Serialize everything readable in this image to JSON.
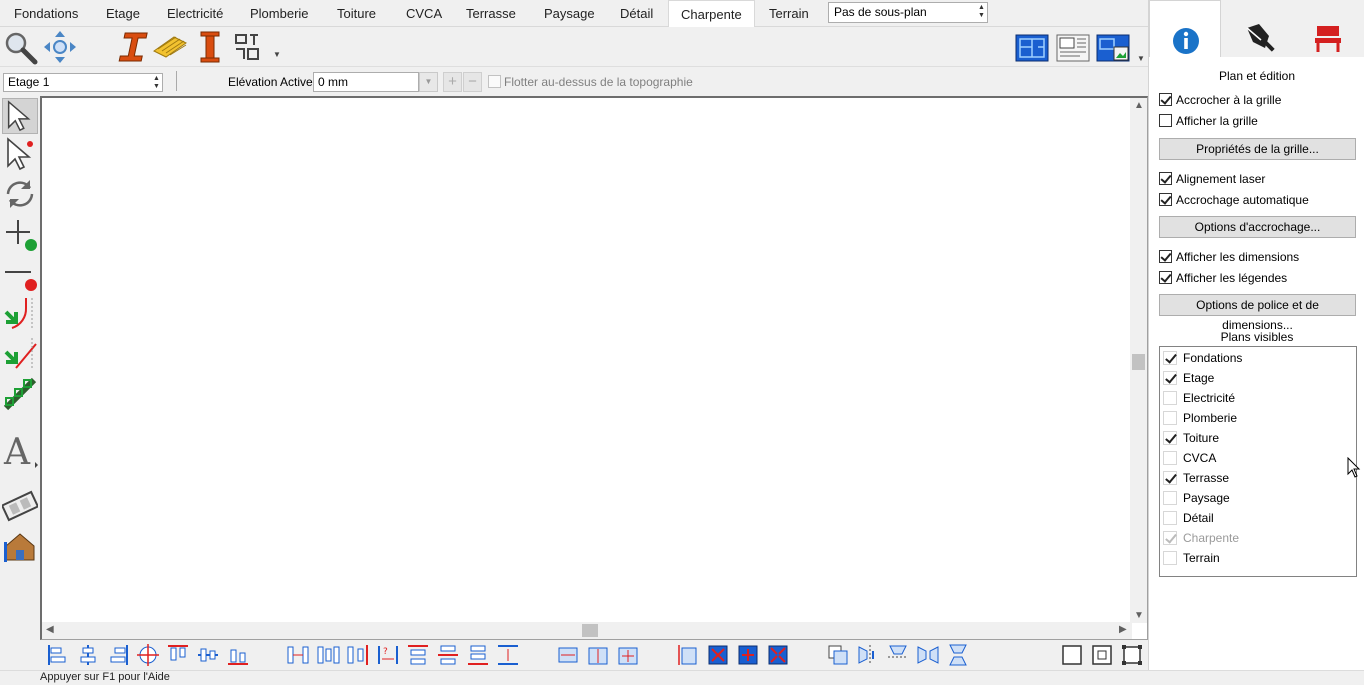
{
  "tabs": [
    "Fondations",
    "Etage",
    "Electricité",
    "Plomberie",
    "Toiture",
    "CVCA",
    "Terrasse",
    "Paysage",
    "Détail",
    "Charpente",
    "Terrain"
  ],
  "active_tab": "Charpente",
  "subplan": {
    "value": "Pas de sous-plan"
  },
  "level_row": {
    "level": "Etage 1",
    "elevation_label": "Elévation Active:",
    "elevation_value": "0 mm",
    "float_label": "Flotter au-dessus de la topographie",
    "float_checked": false
  },
  "panel": {
    "section_title": "Plan et édition",
    "snap_grid": "Accrocher à la grille",
    "show_grid": "Afficher la grille",
    "grid_props_button": "Propriétés de la grille...",
    "laser_align": "Alignement laser",
    "auto_snap": "Accrochage automatique",
    "snap_options_button": "Options d'accrochage...",
    "show_dimensions": "Afficher les dimensions",
    "show_legends": "Afficher les légendes",
    "font_dim_button": "Options de police et de dimensions...",
    "visible_plans_title": "Plans visibles",
    "visible_plans": [
      {
        "name": "Fondations",
        "checked": true
      },
      {
        "name": "Etage",
        "checked": true
      },
      {
        "name": "Electricité",
        "checked": false
      },
      {
        "name": "Plomberie",
        "checked": false
      },
      {
        "name": "Toiture",
        "checked": true
      },
      {
        "name": "CVCA",
        "checked": false
      },
      {
        "name": "Terrasse",
        "checked": true
      },
      {
        "name": "Paysage",
        "checked": false
      },
      {
        "name": "Détail",
        "checked": false
      },
      {
        "name": "Charpente",
        "checked": true,
        "disabled": true
      },
      {
        "name": "Terrain",
        "checked": false
      }
    ]
  },
  "status": "Appuyer sur F1 pour l'Aide",
  "colors": {
    "accent_blue": "#1a73c8",
    "steel_orange": "#d94d10",
    "beam_yellow": "#f2c230",
    "red": "#e02020",
    "green": "#1da035"
  }
}
